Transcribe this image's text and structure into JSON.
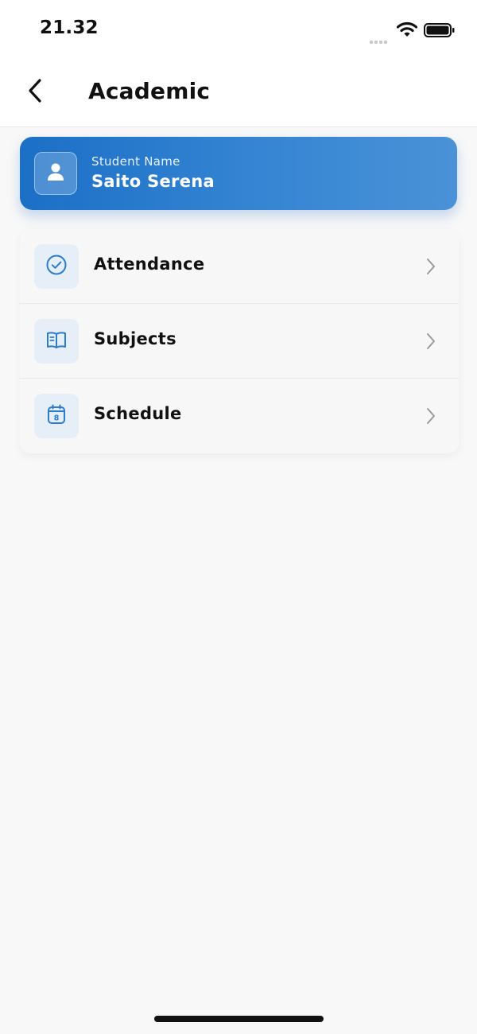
{
  "status_bar": {
    "time": "21.32",
    "icons": [
      "signal-icon",
      "wifi-icon",
      "battery-icon"
    ]
  },
  "header": {
    "title": "Academic",
    "back_icon": "chevron-left-icon"
  },
  "student_card": {
    "label": "Student Name",
    "name": "Saito Serena",
    "icon": "person-icon",
    "colors": {
      "gradient_start": "#1b6fc6",
      "gradient_end": "#4a92d7"
    }
  },
  "menu": {
    "items": [
      {
        "label": "Attendance",
        "icon": "check-circle-icon"
      },
      {
        "label": "Subjects",
        "icon": "book-icon"
      },
      {
        "label": "Schedule",
        "icon": "calendar-icon",
        "icon_text": "8"
      }
    ],
    "chevron_icon": "chevron-right-icon"
  },
  "colors": {
    "accent": "#2a7ccf",
    "icon_tile": "#e6eef7",
    "background": "#f8f8f8"
  }
}
